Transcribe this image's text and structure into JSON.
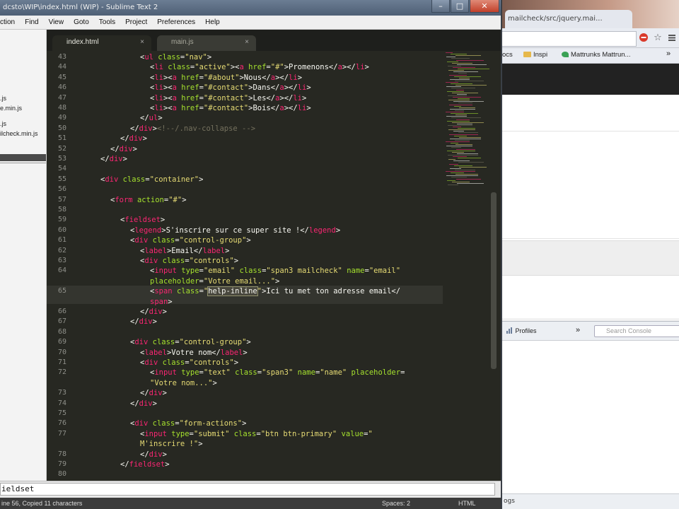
{
  "sublime": {
    "title": "dcsto\\WIP\\index.html (WIP) - Sublime Text 2",
    "window_controls": [
      "–",
      "□",
      "✕"
    ],
    "menu": [
      "ction",
      "Find",
      "View",
      "Goto",
      "Tools",
      "Project",
      "Preferences",
      "Help"
    ],
    "sidebar_files": [
      ".js",
      "e.min.js",
      ".js",
      "ilcheck.min.js"
    ],
    "tabs": [
      {
        "label": "index.html",
        "close": "×"
      },
      {
        "label": "main.js",
        "close": "×"
      }
    ],
    "line_numbers": [
      "43",
      "44",
      "45",
      "46",
      "47",
      "48",
      "49",
      "50",
      "51",
      "52",
      "53",
      "54",
      "55",
      "56",
      "57",
      "58",
      "59",
      "60",
      "61",
      "62",
      "63",
      "64",
      "",
      "65",
      "",
      "66",
      "67",
      "68",
      "69",
      "70",
      "71",
      "72",
      "",
      "73",
      "74",
      "75",
      "76",
      "77",
      "",
      "78",
      "79",
      "80"
    ],
    "panel_input": "ieldset",
    "status": {
      "left": "ine 56, Copied 11 characters",
      "spaces": "Spaces: 2",
      "syntax": "HTML"
    }
  },
  "browser": {
    "tab_title": "mailcheck/src/jquery.mai...",
    "bookmarks": [
      {
        "label": "ocs"
      },
      {
        "label": "Inspi"
      },
      {
        "label": "Mattrunks Mattrun..."
      }
    ],
    "bookmark_more": "»",
    "devtools": {
      "profiles": "Profiles",
      "more": "»",
      "search_placeholder": "Search Console"
    },
    "console_foot": "ogs"
  },
  "colors": {
    "tag": "#f92672",
    "attr": "#a6e22e",
    "string": "#e6db74",
    "comment": "#75715e",
    "text": "#f8f8f2",
    "bg": "#272822"
  }
}
